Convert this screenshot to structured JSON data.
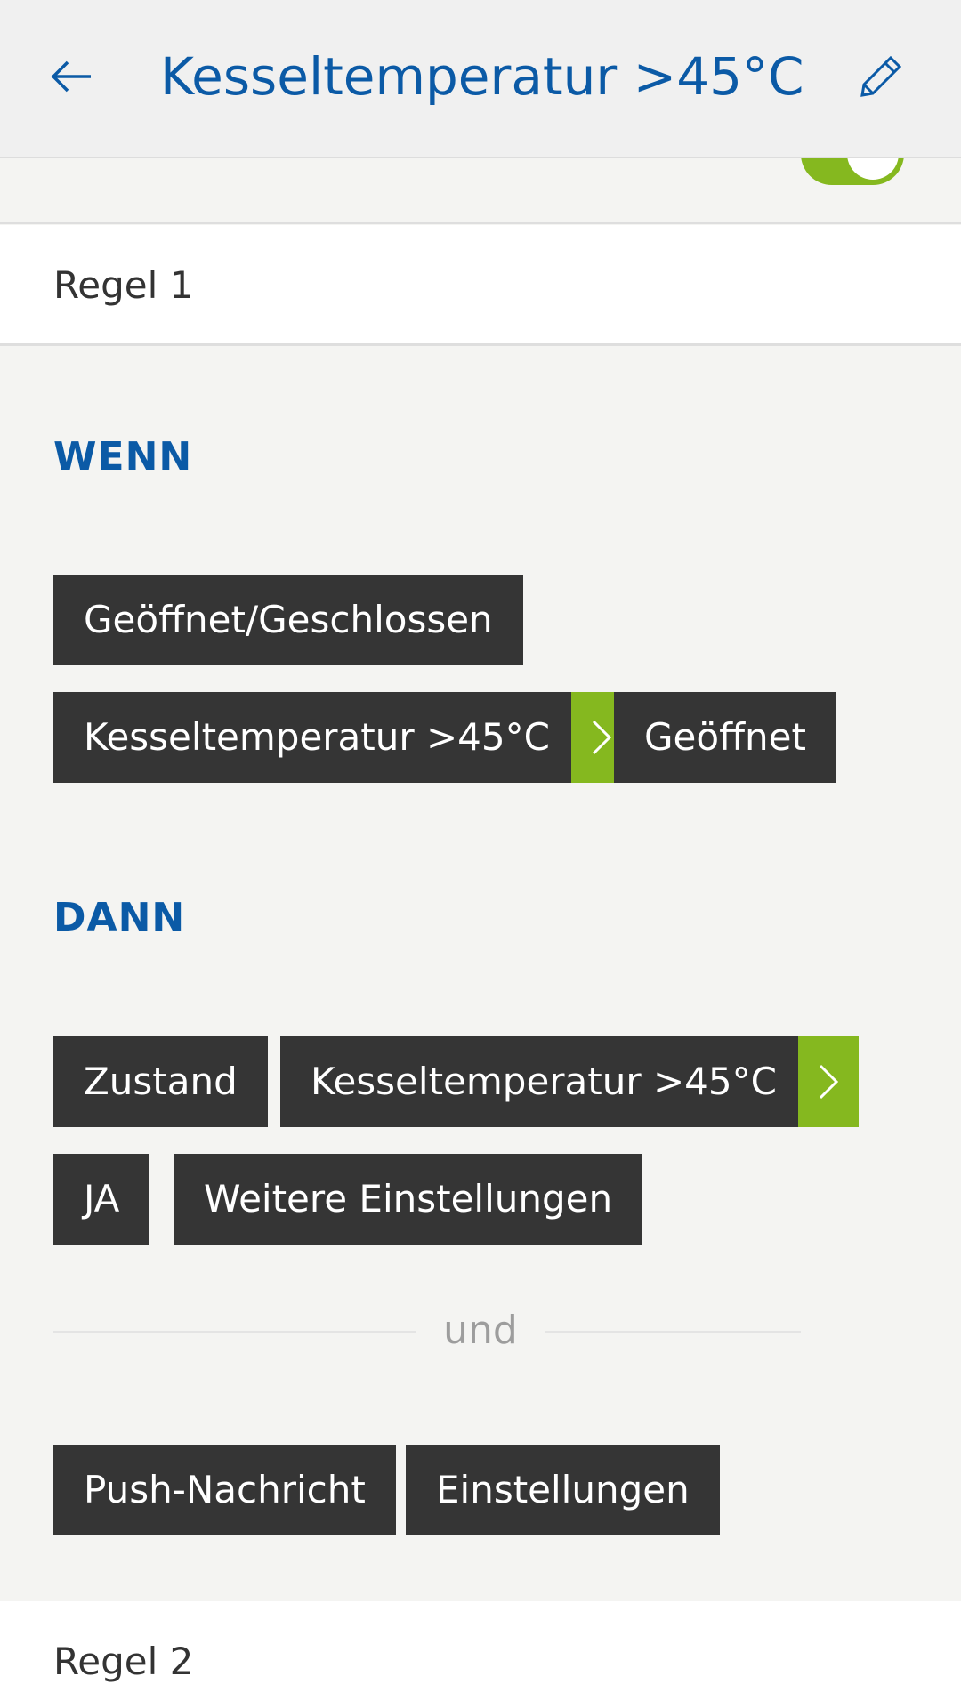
{
  "header": {
    "title": "Kesseltemperatur >45°C",
    "back_icon": "arrow-left-icon",
    "edit_icon": "pencil-icon"
  },
  "toggle": {
    "state": "on",
    "color": "#85b81f"
  },
  "rules": [
    {
      "label": "Regel 1",
      "when": {
        "label": "WENN",
        "chips": [
          "Geöffnet/Geschlossen",
          "Kesseltemperatur >45°C",
          "Geöffnet"
        ]
      },
      "then": {
        "label": "DANN",
        "chips": [
          "Zustand",
          "Kesseltemperatur >45°C",
          "JA",
          "Weitere Einstellungen"
        ]
      },
      "and_label": "und",
      "then_extra": {
        "chips": [
          "Push-Nachricht",
          "Einstellungen"
        ]
      }
    },
    {
      "label": "Regel 2"
    }
  ],
  "colors": {
    "accent_blue": "#0b5aa6",
    "accent_green": "#85b81f",
    "chip_bg": "#353535",
    "background": "#f4f4f2"
  }
}
